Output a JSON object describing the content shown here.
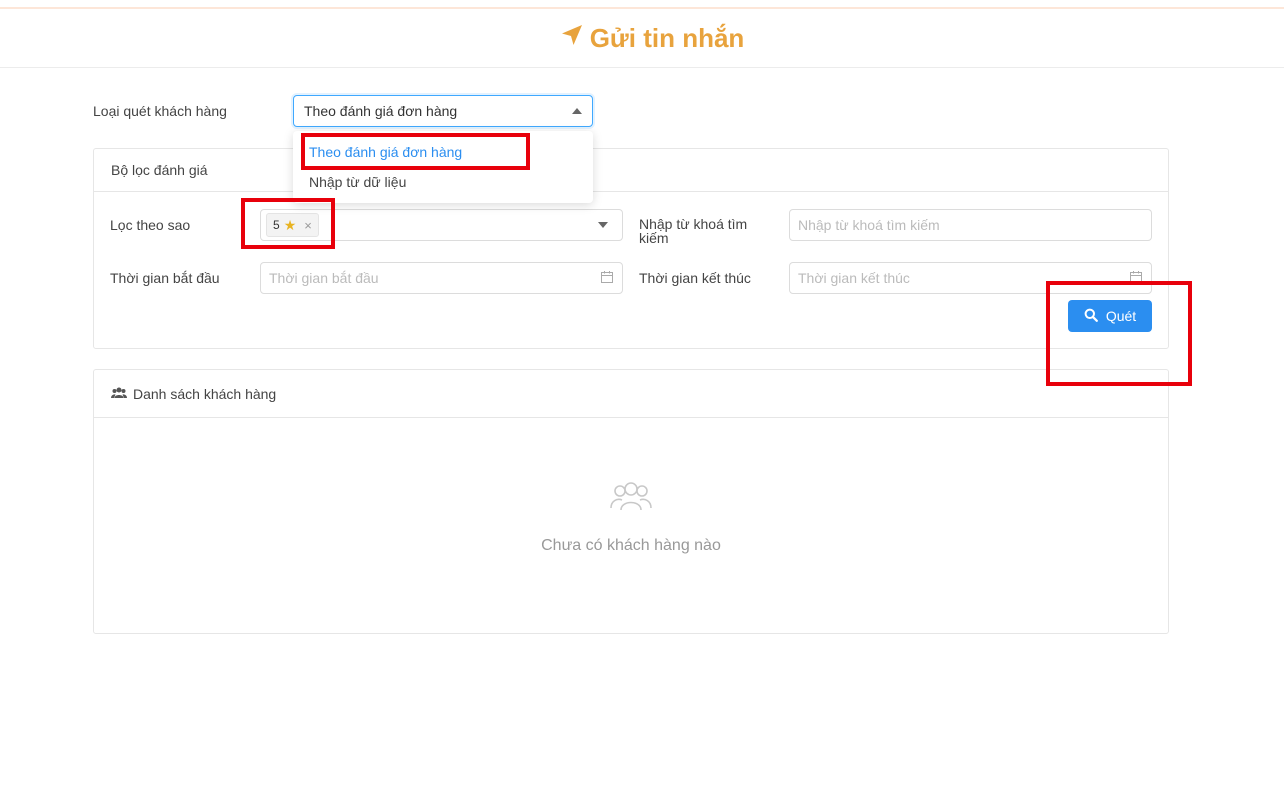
{
  "page": {
    "title": "Gửi tin nhắn",
    "accent_color": "#e8a33d",
    "primary_color": "#2b8ef0"
  },
  "scan_type": {
    "label": "Loại quét khách hàng",
    "value": "Theo đánh giá đơn hàng",
    "options": [
      "Theo đánh giá đơn hàng",
      "Nhập từ dữ liệu"
    ]
  },
  "filter": {
    "title": "Bộ lọc đánh giá",
    "star_label": "Lọc theo sao",
    "star_tag": "5",
    "keyword_label": "Nhập từ khoá tìm kiếm",
    "keyword_placeholder": "Nhập từ khoá tìm kiếm",
    "start_label": "Thời gian bắt đầu",
    "start_placeholder": "Thời gian bắt đầu",
    "end_label": "Thời gian kết thúc",
    "end_placeholder": "Thời gian kết thúc",
    "scan_button": "Quét"
  },
  "customers": {
    "title": "Danh sách khách hàng",
    "empty_text": "Chưa có khách hàng nào"
  }
}
